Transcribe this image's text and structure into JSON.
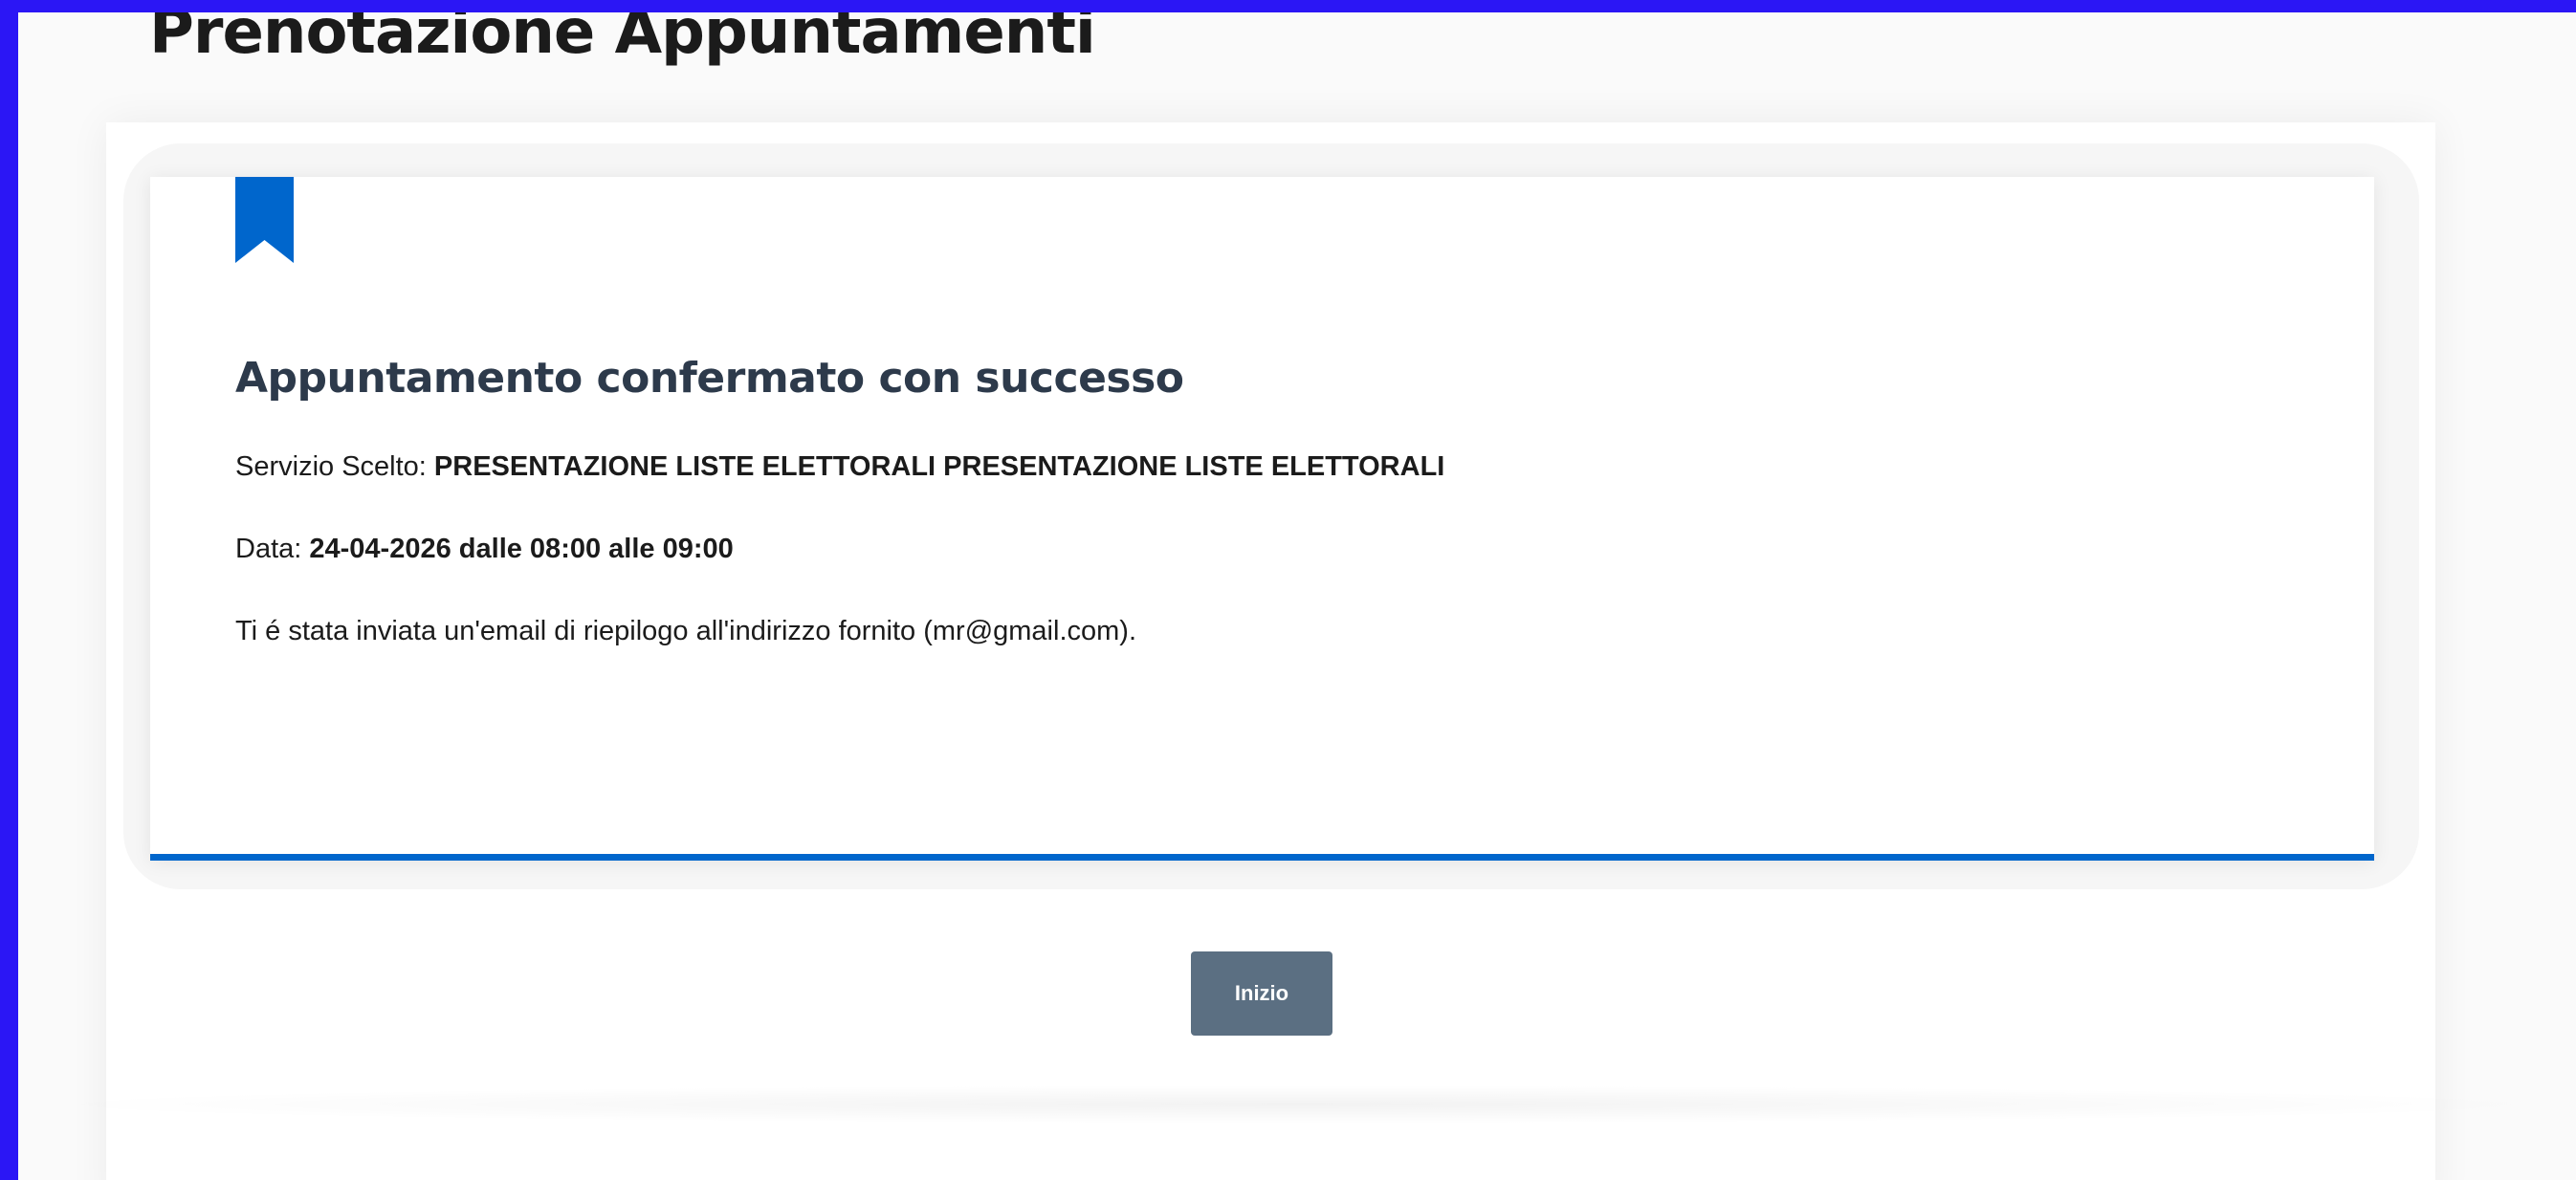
{
  "page": {
    "title": "Prenotazione Appuntamenti"
  },
  "confirmation": {
    "title": "Appuntamento confermato con successo",
    "service_label": "Servizio Scelto:",
    "service_value": "PRESENTAZIONE LISTE ELETTORALI PRESENTAZIONE LISTE ELETTORALI",
    "date_label": "Data:",
    "date_value": "24-04-2026 dalle 08:00 alle 09:00",
    "email_message": "Ti é stata inviata un'email di riepilogo all'indirizzo fornito (mr@gmail.com)."
  },
  "actions": {
    "home_label": "Inizio"
  },
  "icons": {
    "bookmark": "bookmark-icon"
  },
  "colors": {
    "frame": "#2b16f5",
    "accent": "#0066cc",
    "title_text": "#2d3a4b",
    "button_bg": "#5b6f82"
  }
}
